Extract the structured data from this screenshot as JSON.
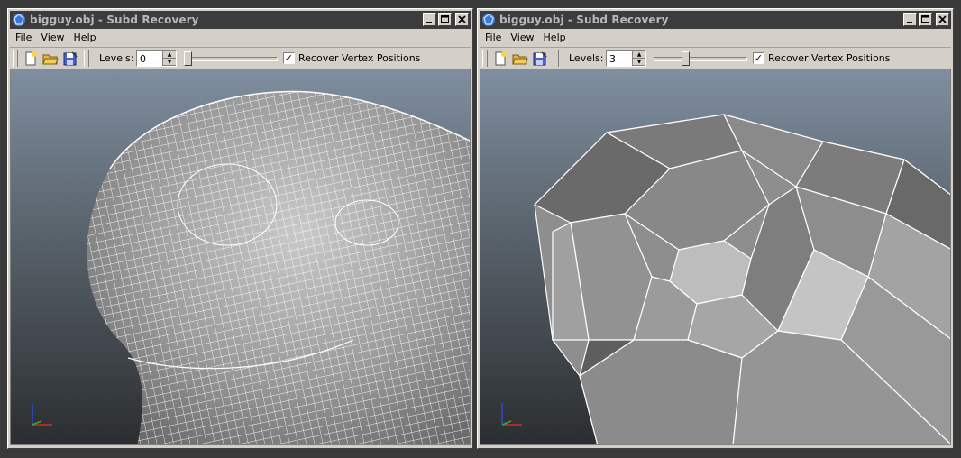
{
  "windows": [
    {
      "id": "left",
      "title": "bigguy.obj - Subd Recovery",
      "menu": [
        "File",
        "View",
        "Help"
      ],
      "toolbar": {
        "levels_label": "Levels:",
        "levels_value": "0",
        "slider_fraction": 0.0,
        "checkbox_label": "Recover Vertex Positions",
        "checkbox_checked": true,
        "checkbox_mark": "✓"
      }
    },
    {
      "id": "right",
      "title": "bigguy.obj - Subd Recovery",
      "menu": [
        "File",
        "View",
        "Help"
      ],
      "toolbar": {
        "levels_label": "Levels:",
        "levels_value": "3",
        "slider_fraction": 0.33,
        "checkbox_label": "Recover Vertex Positions",
        "checkbox_checked": true,
        "checkbox_mark": "✓"
      }
    }
  ],
  "icons": {
    "app": "subd-app-icon",
    "toolbar": [
      "new-file-icon",
      "open-folder-icon",
      "save-disk-icon"
    ],
    "title_buttons": [
      "minimize-icon",
      "maximize-icon",
      "close-icon"
    ]
  },
  "colors": {
    "titlebar": "#3c3c3c",
    "title_text": "#b8b8b8",
    "window_face": "#d4d0c8",
    "viewport_top": "#7f8ea0",
    "viewport_bottom": "#2b2e30",
    "mesh_face": "#9c9c9c",
    "mesh_edge": "#ffffff"
  }
}
